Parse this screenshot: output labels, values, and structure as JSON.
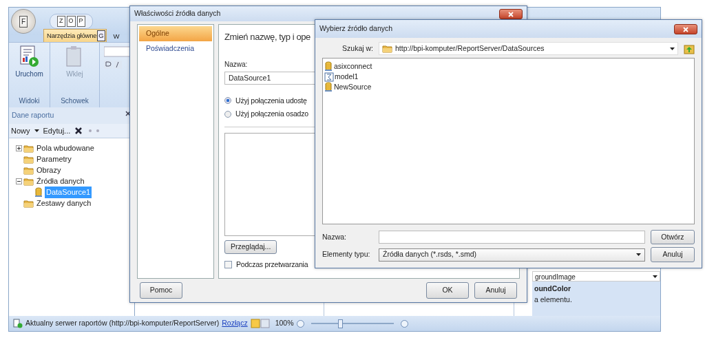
{
  "app": {
    "app_button": "F",
    "quick_access": [
      "Z",
      "O",
      "P"
    ],
    "ribbon_tabs": [
      {
        "label": "Narzędzia główne",
        "keytip": "G",
        "selected": true
      },
      {
        "label": "W",
        "selected": false
      }
    ],
    "ribbon_groups": [
      {
        "label": "Widoki",
        "button": "Uruchom",
        "disabled": false
      },
      {
        "label": "Schowek",
        "button": "Wklej",
        "disabled": true
      }
    ],
    "pane": {
      "title": "Dane raportu",
      "toolbar": [
        "Nowy",
        "Edytuj..."
      ],
      "tree": [
        {
          "label": "Pola wbudowane",
          "expanded": false,
          "selected": false
        },
        {
          "label": "Parametry",
          "selected": false
        },
        {
          "label": "Obrazy",
          "selected": false
        },
        {
          "label": "Źródła danych",
          "expanded": true,
          "selected": false,
          "children": [
            {
              "label": "DataSource1",
              "selected": true
            }
          ]
        },
        {
          "label": "Zestawy danych",
          "selected": false
        }
      ]
    },
    "properties": {
      "property": "groundImage",
      "description_title": "oundColor",
      "description": "a elementu."
    },
    "status_bar": {
      "text": "Aktualny serwer raportów (http://bpi-komputer/ReportServer)",
      "link": "Rozłącz",
      "zoom": "100%",
      "level": 0.35
    }
  },
  "properties_dialog": {
    "title": "Właściwości źródła danych",
    "nav": [
      {
        "label": "Ogólne",
        "selected": true
      },
      {
        "label": "Poświadczenia",
        "selected": false
      }
    ],
    "heading": "Zmień nazwę, typ i ope",
    "name_label": "Nazwa:",
    "name_value": "DataSource1",
    "radios": [
      {
        "label": "Użyj połączenia udostę",
        "selected": true
      },
      {
        "label": "Użyj połączenia osadzo",
        "selected": false
      }
    ],
    "browse": "Przeglądaj...",
    "checkbox": {
      "label": "Podczas przetwarzania",
      "checked": false
    },
    "help": "Pomoc",
    "ok": "OK",
    "cancel": "Anuluj"
  },
  "source_dialog": {
    "title": "Wybierz źródło danych",
    "look_in_label": "Szukaj w:",
    "look_in": "http://bpi-komputer/ReportServer/DataSources",
    "files": [
      {
        "name": "asixconnect",
        "kind": "source"
      },
      {
        "name": "model1",
        "kind": "model"
      },
      {
        "name": "NewSource",
        "kind": "source"
      }
    ],
    "name_label": "Nazwa:",
    "type_label": "Elementy typu:",
    "type_value": "Źródła danych (*.rsds, *.smd)",
    "open": "Otwórz",
    "cancel": "Anuluj"
  }
}
